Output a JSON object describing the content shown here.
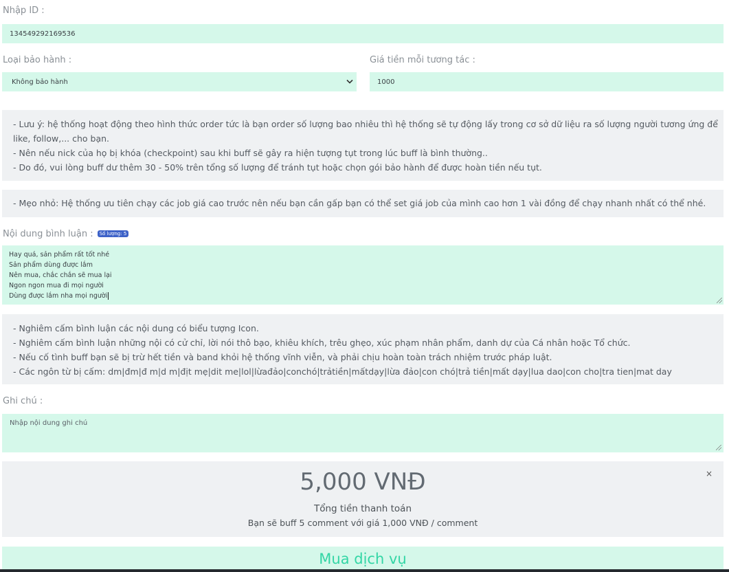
{
  "id_field": {
    "label": "Nhập ID :",
    "value": "134549292169536"
  },
  "warranty": {
    "label": "Loại bảo hành :",
    "selected": "Không bảo hành"
  },
  "price": {
    "label": "Giá tiền mỗi tương tác :",
    "value": "1000"
  },
  "notice1": {
    "line1": "- Lưu ý: hệ thống hoạt động theo hình thức order tức là bạn order số lượng bao nhiêu thì hệ thống sẽ tự động lấy trong cơ sở dữ liệu ra số lượng người tương ứng để",
    "line2": "like, follow,... cho bạn.",
    "line3": "- Nên nếu nick của họ bị khóa (checkpoint) sau khi buff sẽ gây ra hiện tượng tụt trong lúc buff là bình thường..",
    "line4": "- Do đó, vui lòng buff dư thêm 30 - 50% trên tổng số lượng để tránh tụt hoặc chọn gói bảo hành để được hoàn tiền nếu tụt."
  },
  "tip": {
    "text": "- Mẹo nhỏ: Hệ thống ưu tiên chạy các job giá cao trước nên nếu bạn cần gấp bạn có thể set giá job của mình cao hơn 1 vài đồng để chạy nhanh nhất có thể nhé."
  },
  "comments": {
    "label": "Nội dung bình luận :",
    "badge": "Số lượng: 5",
    "lines": [
      "Hay quá, sản phẩm rất tốt nhé",
      "Sản phẩm dùng được lắm",
      "Nên mua, chắc chắn sẽ mua lại",
      "Ngon ngon mua đi mọi người",
      "Dùng được lắm nha mọi người"
    ]
  },
  "rules": {
    "line1": "- Nghiêm cấm bình luận các nội dung có biểu tượng Icon.",
    "line2": "- Nghiêm cấm bình luận những nội có cử chỉ, lời nói thô bạo, khiêu khích, trêu ghẹo, xúc phạm nhân phẩm, danh dự của Cá nhân hoặc Tổ chức.",
    "line3": "- Nếu cố tình buff bạn sẽ bị trừ hết tiền và band khỏi hệ thống vĩnh viễn, và phải chịu hoàn toàn trách nhiệm trước pháp luật.",
    "line4": "- Các ngôn từ bị cấm: dm|đm|đ m|d m|địt mẹ|dit me|lol|lừađảo|conchó|trảtiền|mấtdạy|lừa đảo|con chó|trả tiền|mất dạy|lua dao|con cho|tra tien|mat day"
  },
  "note": {
    "label": "Ghi chú :",
    "placeholder": "Nhập nội dung ghi chú"
  },
  "total": {
    "amount": "5,000 VNĐ",
    "caption": "Tổng tiền thanh toán",
    "detail": "Bạn sẽ buff 5 comment với giá 1,000 VNĐ / comment",
    "close": "×"
  },
  "buy_button": {
    "label": "Mua dịch vụ"
  }
}
